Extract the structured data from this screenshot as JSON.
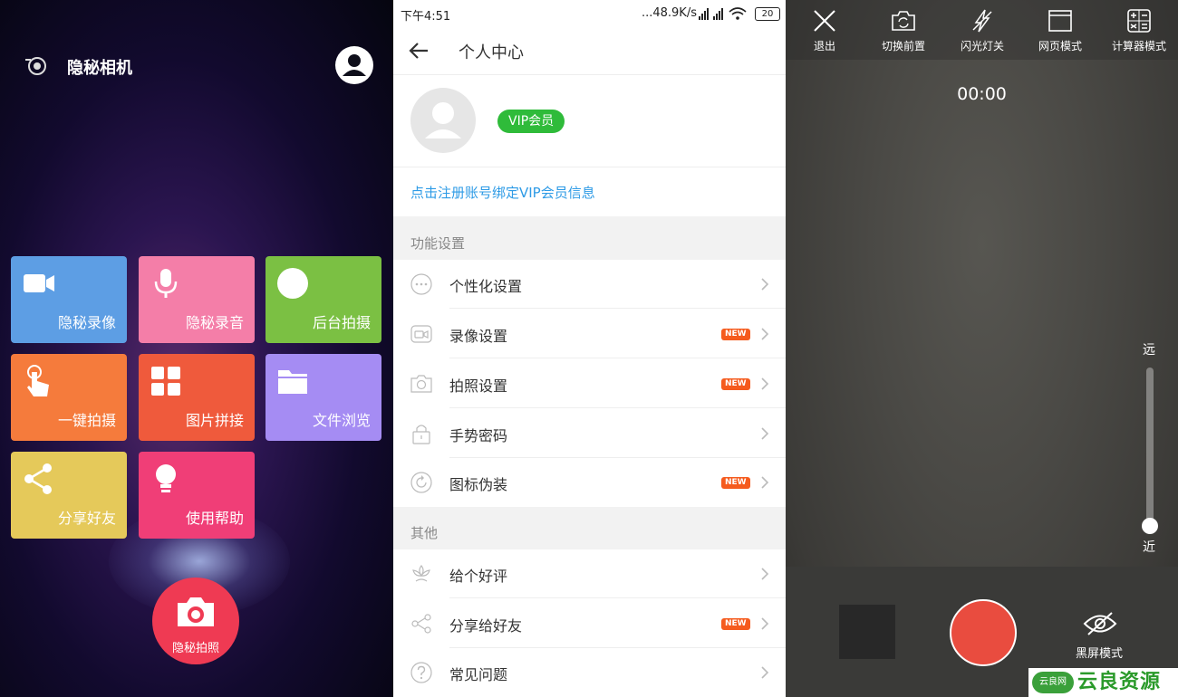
{
  "panel1": {
    "title": "隐秘相机",
    "tiles": [
      {
        "label": "隐秘录像",
        "color": "#5d9ee4",
        "icon": "video-camera-icon"
      },
      {
        "label": "隐秘录音",
        "color": "#f47ea8",
        "icon": "microphone-icon"
      },
      {
        "label": "后台拍摄",
        "color": "#7bc043",
        "icon": "circle-icon"
      },
      {
        "label": "一键拍摄",
        "color": "#f57b3c",
        "icon": "tap-hand-icon"
      },
      {
        "label": "图片拼接",
        "color": "#ef5a3c",
        "icon": "grid-icon"
      },
      {
        "label": "文件浏览",
        "color": "#a58cf3",
        "icon": "folder-icon"
      },
      {
        "label": "分享好友",
        "color": "#e5c95a",
        "icon": "share-icon"
      },
      {
        "label": "使用帮助",
        "color": "#f03e77",
        "icon": "lightbulb-icon"
      }
    ],
    "capture_label": "隐秘拍照"
  },
  "panel2": {
    "status": {
      "time": "下午4:51",
      "net": "...48.9K/s",
      "battery": "20"
    },
    "title": "个人中心",
    "vip_badge": "VIP会员",
    "bind_link": "点击注册账号绑定VIP会员信息",
    "section1": "功能设置",
    "section2": "其他",
    "new_label": "NEW",
    "rows": [
      {
        "label": "个性化设置",
        "icon": "more-dots-icon",
        "new": false
      },
      {
        "label": "录像设置",
        "icon": "video-icon",
        "new": true
      },
      {
        "label": "拍照设置",
        "icon": "camera-icon",
        "new": true
      },
      {
        "label": "手势密码",
        "icon": "lock-icon",
        "new": false
      },
      {
        "label": "图标伪装",
        "icon": "refresh-icon",
        "new": true
      },
      {
        "label": "给个好评",
        "icon": "flower-icon",
        "new": false
      },
      {
        "label": "分享给好友",
        "icon": "share-icon",
        "new": true
      },
      {
        "label": "常见问题",
        "icon": "question-icon",
        "new": false
      }
    ]
  },
  "panel3": {
    "toolbar": [
      {
        "label": "退出",
        "icon": "close-icon"
      },
      {
        "label": "切换前置",
        "icon": "switch-camera-icon"
      },
      {
        "label": "闪光灯关",
        "icon": "flash-off-icon"
      },
      {
        "label": "网页模式",
        "icon": "browser-icon"
      },
      {
        "label": "计算器模式",
        "icon": "calculator-icon"
      }
    ],
    "timer": "00:00",
    "zoom_far": "远",
    "zoom_near": "近",
    "zoom_level": 0,
    "black_screen_label": "黑屏模式",
    "record_color": "#e94c3f"
  },
  "watermark": {
    "badge": "云良网",
    "text": "云良资源网"
  }
}
